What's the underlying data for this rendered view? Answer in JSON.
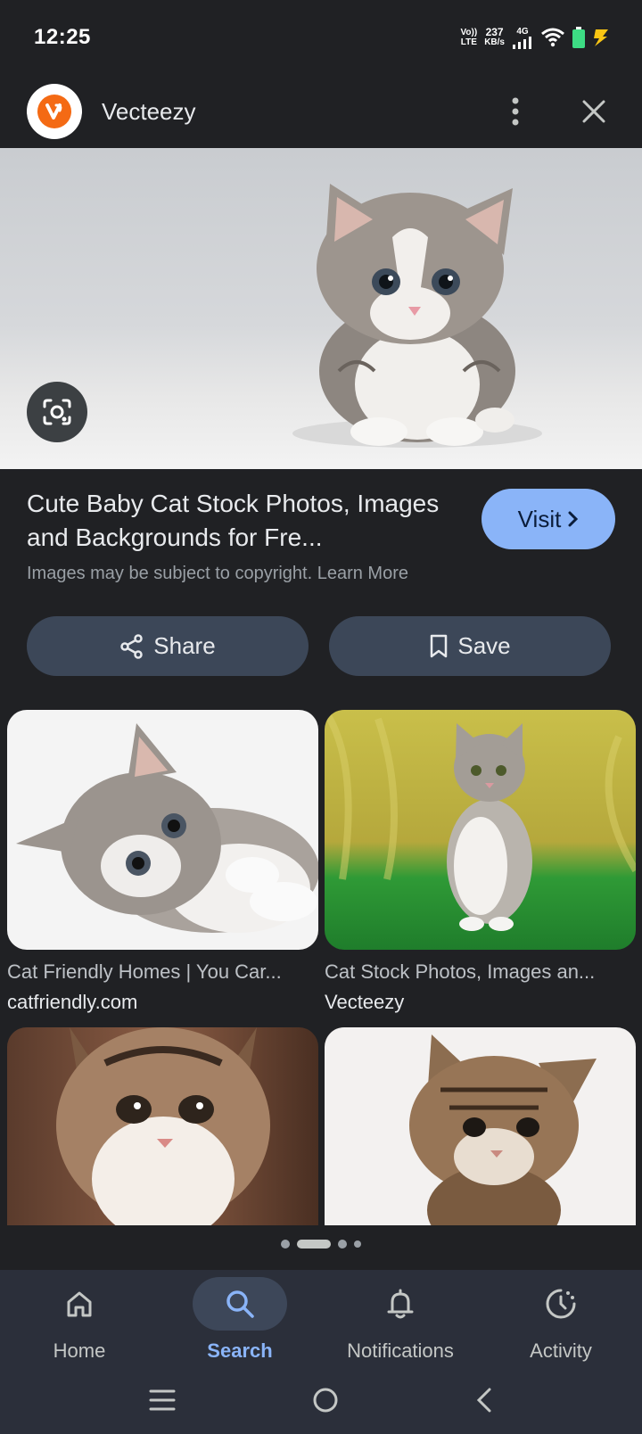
{
  "status_bar": {
    "time": "12:25",
    "volte_top": "Vo))",
    "volte_bottom": "LTE",
    "speed_value": "237",
    "speed_unit": "KB/s",
    "network": "4G"
  },
  "header": {
    "site_name": "Vecteezy",
    "logo_letter": "v"
  },
  "result": {
    "title": "Cute Baby Cat Stock Photos, Images and Backgrounds for Fre...",
    "copyright": "Images may be subject to copyright. Learn More",
    "visit_label": "Visit"
  },
  "actions": {
    "share_label": "Share",
    "save_label": "Save"
  },
  "related": [
    {
      "title": "Cat Friendly Homes | You Car...",
      "source": "catfriendly.com"
    },
    {
      "title": "Cat Stock Photos, Images an...",
      "source": "Vecteezy"
    }
  ],
  "bottom_nav": {
    "items": [
      {
        "label": "Home",
        "icon": "home-icon"
      },
      {
        "label": "Search",
        "icon": "search-icon",
        "active": true
      },
      {
        "label": "Notifications",
        "icon": "bell-icon"
      },
      {
        "label": "Activity",
        "icon": "activity-icon"
      }
    ]
  },
  "colors": {
    "background": "#202124",
    "accent": "#8ab4f8",
    "button_bg": "#3c4758",
    "brand_orange": "#f46a14"
  }
}
